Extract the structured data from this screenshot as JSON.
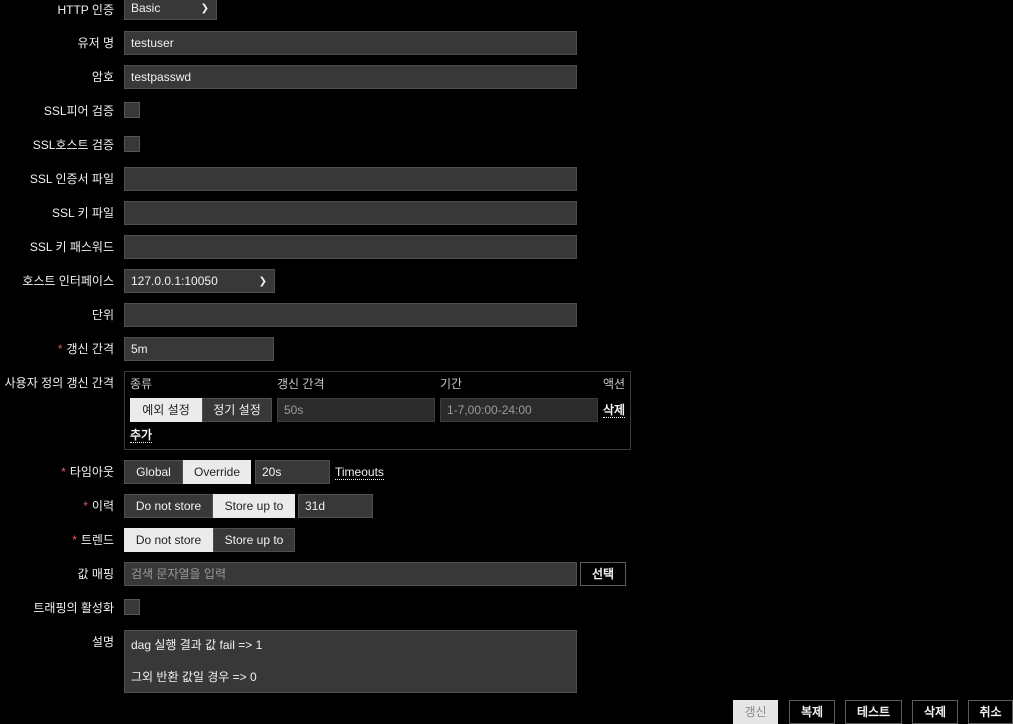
{
  "http_auth": {
    "label": "HTTP 인증",
    "value": "Basic"
  },
  "username": {
    "label": "유저 명",
    "value": "testuser"
  },
  "password": {
    "label": "암호",
    "value": "testpasswd"
  },
  "ssl_verify_peer": {
    "label": "SSL피어 검증"
  },
  "ssl_verify_host": {
    "label": "SSL호스트 검증"
  },
  "ssl_cert_file": {
    "label": "SSL 인증서 파일",
    "value": ""
  },
  "ssl_key_file": {
    "label": "SSL 키 파일",
    "value": ""
  },
  "ssl_key_password": {
    "label": "SSL 키 패스워드",
    "value": ""
  },
  "host_interface": {
    "label": "호스트 인터페이스",
    "value": "127.0.0.1:10050"
  },
  "units": {
    "label": "단위",
    "value": ""
  },
  "update_interval": {
    "label": "갱신 간격",
    "value": "5m"
  },
  "custom_intervals": {
    "label": "사용자 정의 갱신 간격",
    "headers": {
      "type": "종류",
      "interval": "갱신 간격",
      "period": "기간",
      "action": "액션"
    },
    "row": {
      "flexible": "예외 설정",
      "scheduling": "정기 설정",
      "interval_value": "50s",
      "period_value": "1-7,00:00-24:00",
      "remove": "삭제"
    },
    "add": "추가"
  },
  "timeout": {
    "label": "타임아웃",
    "global": "Global",
    "override": "Override",
    "value": "20s",
    "link": "Timeouts"
  },
  "history": {
    "label": "이력",
    "do_not_store": "Do not store",
    "store_up_to": "Store up to",
    "value": "31d"
  },
  "trends": {
    "label": "트렌드",
    "do_not_store": "Do not store",
    "store_up_to": "Store up to"
  },
  "value_mapping": {
    "label": "값 매핑",
    "placeholder": "검색 문자열을 입력",
    "select": "선택"
  },
  "populates_inventory": {
    "label": "트래핑의 활성화"
  },
  "description": {
    "label": "설명",
    "line1": "dag 실행 결과 값 fail => 1",
    "line2": "그외 반환 값일 경우 => 0"
  },
  "buttons": {
    "update": "갱신",
    "clone": "복제",
    "test": "테스트",
    "delete": "삭제",
    "cancel": "취소"
  },
  "required_mark": "*",
  "colors": {
    "background": "#000000",
    "input_bg": "#383838",
    "required": "#e45959",
    "segment_active": "#ebebeb"
  },
  "icons": {
    "dropdown": "chevron-down-icon"
  }
}
